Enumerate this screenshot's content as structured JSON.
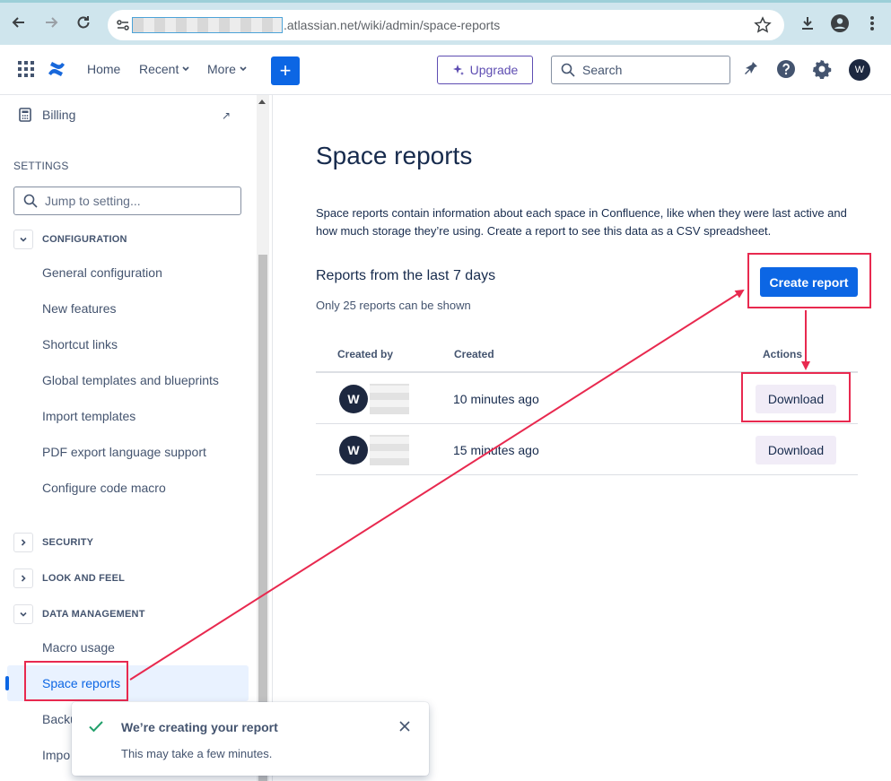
{
  "browser": {
    "url_visible": ".atlassian.net/wiki/admin/space-reports"
  },
  "topnav": {
    "home": "Home",
    "recent": "Recent",
    "more": "More",
    "create_plus": "+",
    "upgrade": "Upgrade",
    "search_placeholder": "Search",
    "user_initial": "W"
  },
  "sidebar": {
    "billing": "Billing",
    "billing_arrow": "↗",
    "settings_heading": "SETTINGS",
    "jump_placeholder": "Jump to setting...",
    "configuration": {
      "label": "CONFIGURATION",
      "items": [
        "General configuration",
        "New features",
        "Shortcut links",
        "Global templates and blueprints",
        "Import templates",
        "PDF export language support",
        "Configure code macro"
      ]
    },
    "security": "SECURITY",
    "look_and_feel": "LOOK AND FEEL",
    "data_management": {
      "label": "DATA MANAGEMENT",
      "items": [
        "Macro usage",
        "Space reports",
        "Backu",
        "Impo"
      ]
    }
  },
  "main": {
    "title": "Space reports",
    "description": "Space reports contain information about each space in Confluence, like when they were last active and how much storage they’re using. Create a report to see this data as a CSV spreadsheet.",
    "reports_heading": "Reports from the last 7 days",
    "reports_sub": "Only 25 reports can be shown",
    "create_button": "Create report",
    "table": {
      "headers": {
        "created_by": "Created by",
        "created": "Created",
        "actions": "Actions"
      },
      "rows": [
        {
          "avatar": "W",
          "created": "10 minutes ago",
          "action": "Download"
        },
        {
          "avatar": "W",
          "created": "15 minutes ago",
          "action": "Download"
        }
      ]
    }
  },
  "toast": {
    "title": "We’re creating your report",
    "body": "This may take a few minutes."
  },
  "colors": {
    "primary": "#0c66e4",
    "annotation": "#e8294f",
    "upgrade": "#5e4db2",
    "success": "#22a06b"
  }
}
